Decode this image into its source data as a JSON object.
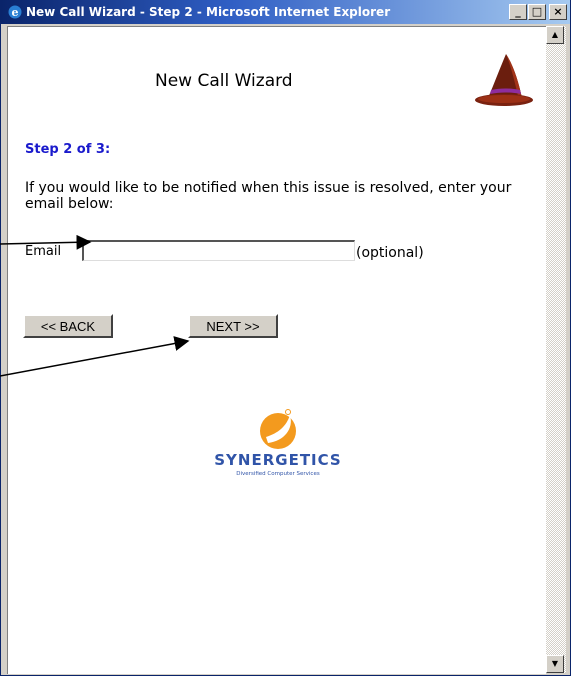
{
  "window": {
    "title": "New Call Wizard - Step 2 - Microsoft Internet Explorer",
    "minimize": "_",
    "maximize": "□",
    "close": "×"
  },
  "wizard": {
    "heading": "New Call Wizard",
    "step": "Step 2 of 3:",
    "instructions": "If you would like to be notified when this issue is resolved, enter your email below:",
    "email_label": "Email",
    "email_value": "",
    "optional": "(optional)",
    "back_label": "<< BACK",
    "next_label": "NEXT >>"
  },
  "logo": {
    "name": "SYNERGETICS",
    "tagline": "Diversified Computer Services",
    "colors": {
      "orange": "#f39a1e",
      "blue": "#3054a8"
    }
  },
  "icons": {
    "hat": "wizard-hat-icon",
    "browser": "internet-explorer-icon"
  }
}
